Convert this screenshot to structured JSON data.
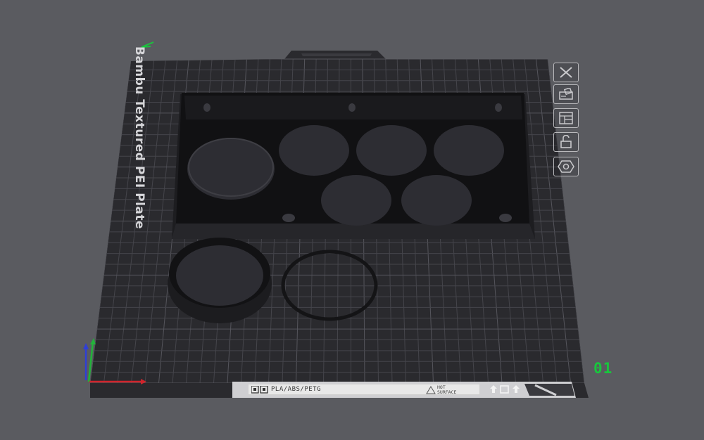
{
  "plate": {
    "label": "Bambu Textured PEI Plate",
    "number": "01",
    "material_text": "PLA/ABS/PETG",
    "hot_surface_line1": "HOT",
    "hot_surface_line2": "SURFACE"
  },
  "toolbar": [
    {
      "name": "close",
      "icon": "close-icon"
    },
    {
      "name": "arrange",
      "icon": "arrange-icon"
    },
    {
      "name": "layout",
      "icon": "layout-icon"
    },
    {
      "name": "lock",
      "icon": "lock-icon"
    },
    {
      "name": "settings",
      "icon": "hex-settings-icon"
    }
  ],
  "colors": {
    "background": "#5a5b60",
    "plate": "#2a2a2e",
    "grid": "#4a4a50",
    "part": "#141416",
    "plate_number": "#19c53d",
    "axis_x": "#d0242c",
    "axis_y": "#22b33a",
    "axis_z": "#2f3fd6"
  }
}
